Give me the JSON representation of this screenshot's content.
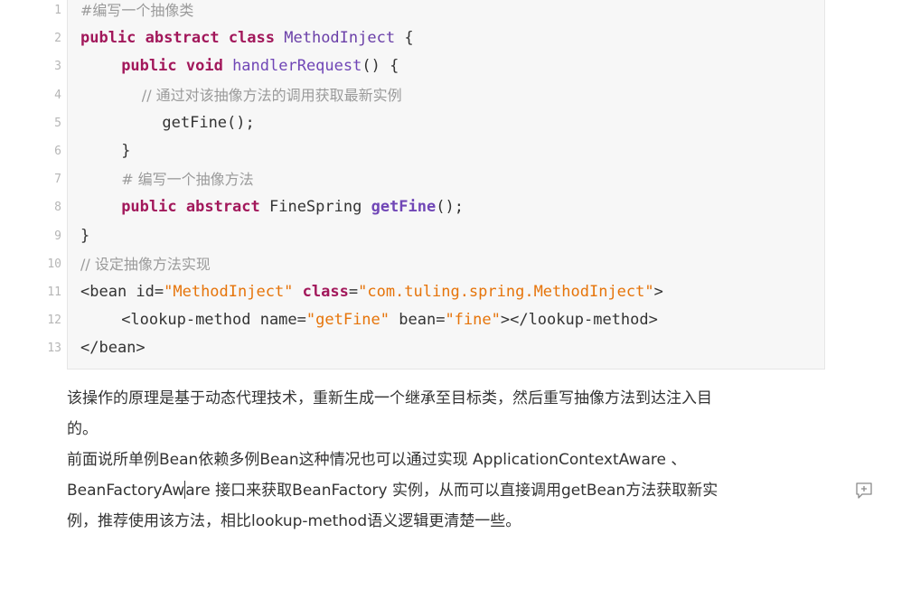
{
  "code_lines": [
    {
      "n": "1",
      "segs": [
        [
          "cm",
          "#编写一个抽像类"
        ]
      ],
      "indent": 0
    },
    {
      "n": "2",
      "segs": [
        [
          "kw",
          "public"
        ],
        [
          "",
          " "
        ],
        [
          "kw",
          "abstract"
        ],
        [
          "",
          " "
        ],
        [
          "kw",
          "class"
        ],
        [
          "",
          " "
        ],
        [
          "ty",
          "MethodInject"
        ],
        [
          "",
          " {"
        ]
      ],
      "indent": 0
    },
    {
      "n": "3",
      "segs": [
        [
          "kw",
          "public"
        ],
        [
          "",
          " "
        ],
        [
          "kw",
          "void"
        ],
        [
          "",
          " "
        ],
        [
          "fn",
          "handlerRequest"
        ],
        [
          "",
          "() {"
        ]
      ],
      "indent": 4
    },
    {
      "n": "4",
      "segs": [
        [
          "cm",
          "// 通过对该抽像方法的调用获取最新实例"
        ]
      ],
      "indent": 6
    },
    {
      "n": "5",
      "segs": [
        [
          "",
          "getFine();"
        ]
      ],
      "indent": 8
    },
    {
      "n": "6",
      "segs": [
        [
          "",
          "}"
        ]
      ],
      "indent": 4
    },
    {
      "n": "7",
      "segs": [
        [
          "cm",
          "# 编写一个抽像方法"
        ]
      ],
      "indent": 4
    },
    {
      "n": "8",
      "segs": [
        [
          "kw",
          "public"
        ],
        [
          "",
          " "
        ],
        [
          "kw",
          "abstract"
        ],
        [
          "",
          " FineSpring "
        ],
        [
          "fnb",
          "getFine"
        ],
        [
          "",
          "();"
        ]
      ],
      "indent": 4
    },
    {
      "n": "9",
      "segs": [
        [
          "",
          "}"
        ]
      ],
      "indent": 0
    },
    {
      "n": "10",
      "segs": [
        [
          "cm",
          "// 设定抽像方法实现"
        ]
      ],
      "indent": 0
    },
    {
      "n": "11",
      "segs": [
        [
          "tag",
          "<bean id="
        ],
        [
          "str",
          "\"MethodInject\""
        ],
        [
          "",
          " "
        ],
        [
          "kw",
          "class"
        ],
        [
          "tag",
          "="
        ],
        [
          "str",
          "\"com.tuling.spring.MethodInject\""
        ],
        [
          "tag",
          ">"
        ]
      ],
      "indent": 0
    },
    {
      "n": "12",
      "segs": [
        [
          "tag",
          "<lookup-method name="
        ],
        [
          "str",
          "\"getFine\""
        ],
        [
          "tag",
          " bean="
        ],
        [
          "str",
          "\"fine\""
        ],
        [
          "tag",
          "></lookup-method>"
        ]
      ],
      "indent": 4
    },
    {
      "n": "13",
      "segs": [
        [
          "tag",
          "</bean>"
        ]
      ],
      "indent": 0
    }
  ],
  "para1": {
    "line1": "该操作的原理是基于动态代理技术，重新生成一个继承至目标类，然后重写抽像方法到达注入目",
    "line2": "的。"
  },
  "para2": {
    "line1": "前面说所单例Bean依赖多例Bean这种情况也可以通过实现 ApplicationContextAware 、",
    "line2a": "BeanFactoryAw",
    "line2b": "are 接口来获取BeanFactory 实例，从而可以直接调用getBean方法获取新实",
    "line3": "例，推荐使用该方法，相比lookup-method语义逻辑更清楚一些。"
  },
  "icons": {
    "comment": "add-comment-icon"
  },
  "colors": {
    "keyword": "#a2185b",
    "type": "#6a3fa8",
    "string": "#e6740a",
    "comment": "#9a9a9a",
    "code_bg": "#f7f7f7"
  }
}
